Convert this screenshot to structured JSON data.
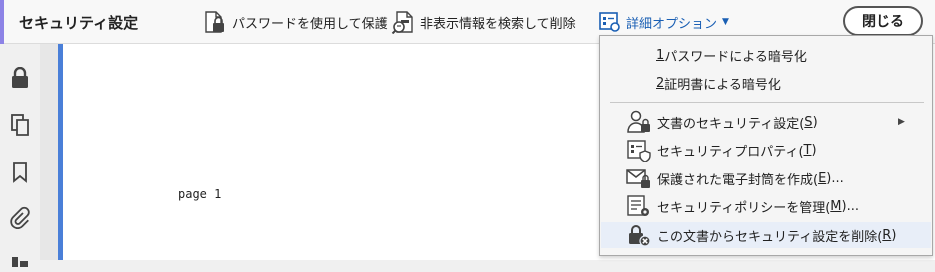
{
  "toolbar": {
    "title": "セキュリティ設定",
    "encrypt_password": "パスワードを使用して保護",
    "redact_search": "非表示情報を検索して削除",
    "advanced_options": "詳細オプション",
    "close": "閉じる"
  },
  "rail": {
    "icons": [
      "lock-icon",
      "copy-pages-icon",
      "bookmark-icon",
      "paperclip-icon",
      "layers-icon"
    ]
  },
  "document": {
    "page_label": "page 1"
  },
  "menu": {
    "items": [
      {
        "num": "1",
        "label": " パスワードによる暗号化"
      },
      {
        "num": "2",
        "label": " 証明書による暗号化"
      },
      {
        "label": "文書のセキュリティ設定(",
        "key": "S",
        "tail": ")"
      },
      {
        "label": "セキュリティプロパティ(",
        "key": "T",
        "tail": ")"
      },
      {
        "label": "保護された電子封筒を作成(",
        "key": "E",
        "tail": ")..."
      },
      {
        "label": "セキュリティポリシーを管理(",
        "key": "M",
        "tail": ")..."
      },
      {
        "label": "この文書からセキュリティ設定を削除(",
        "key": "R",
        "tail": ")"
      }
    ]
  },
  "colors": {
    "accent": "#8d83e6",
    "link_blue": "#1a5fb4",
    "highlight": "#e8eef8"
  }
}
